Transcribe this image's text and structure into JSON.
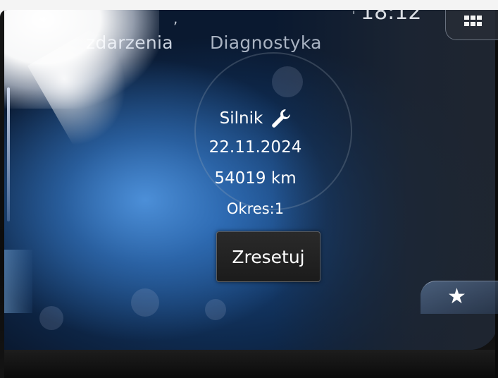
{
  "status_bar": {
    "clock": "18:12"
  },
  "tabs": [
    {
      "label": "zdarzenia"
    },
    {
      "label": "Diagnostyka"
    }
  ],
  "service_item": {
    "title": "Silnik",
    "icon": "wrench-icon",
    "date": "22.11.2024",
    "mileage": "54019 km",
    "period": "Okres:1"
  },
  "reset_button": {
    "label": "Zresetuj"
  },
  "favorites_button": {
    "icon": "star-icon"
  },
  "menu_button": {
    "icon": "grid-icon"
  }
}
